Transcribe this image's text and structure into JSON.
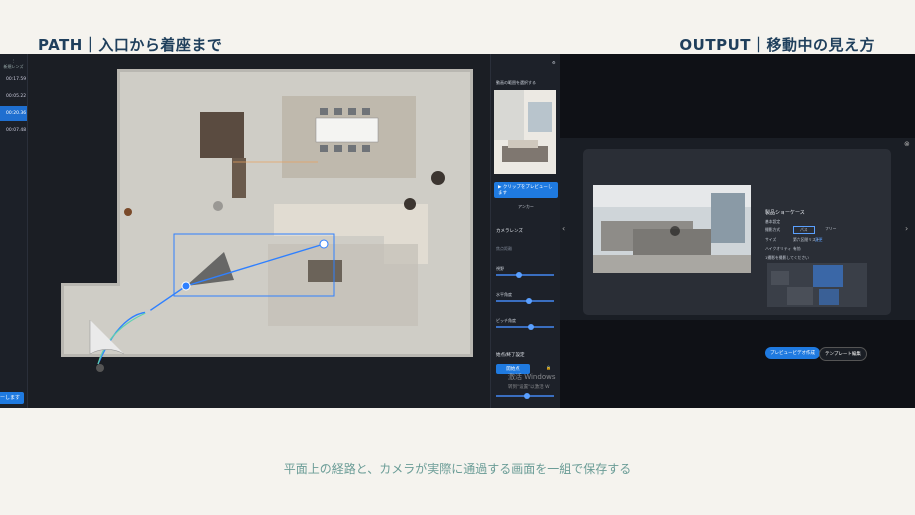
{
  "header": {
    "left": "PATH｜入口から着座まで",
    "right": "OUTPUT｜移動中の見え方"
  },
  "caption": "平面上の経路と、カメラが実際に通過する画面を一組で保存する",
  "left_sidebar": {
    "top_label": "新規レンズ",
    "timestamps": [
      "00:17.59",
      "00:05.22",
      "00:20.36",
      "00:07.48"
    ],
    "active_index": 2,
    "bottom_button": "ーします"
  },
  "right_panel": {
    "preview_title": "動画の範囲を選択する",
    "clip_button": "▶ クリップをプレビューします",
    "anchor_label": "アンカー",
    "camera_lens": "カメラレンズ",
    "field_label": "焦点距離",
    "slider_labels": [
      "視野",
      "水平角度",
      "ピッチ角度"
    ],
    "start_end": "始点/終了設定",
    "start_button": "開始点"
  },
  "modal": {
    "title": "製品ショーケース",
    "basic_settings": "基本設定",
    "mode_label": "撮影方式",
    "option_a": "パス",
    "option_b": "フリー",
    "size_label": "サイズ",
    "size_value": "第六区間リスト",
    "size_link": "変更",
    "hq_label": "ハイクオリティ",
    "hq_value": "有効",
    "path_note": "1撮影を撮影してください",
    "preview_button": "プレビュービデオ作成",
    "template_button": "テンプレート編集"
  },
  "watermark": {
    "line1": "激活 Windows",
    "line2": "转到\"设置\"以激活 W"
  },
  "colors": {
    "accent": "#1f7ae0",
    "path_line": "#2f80ff",
    "caption": "#6a9c96",
    "header": "#1f3f5c"
  }
}
